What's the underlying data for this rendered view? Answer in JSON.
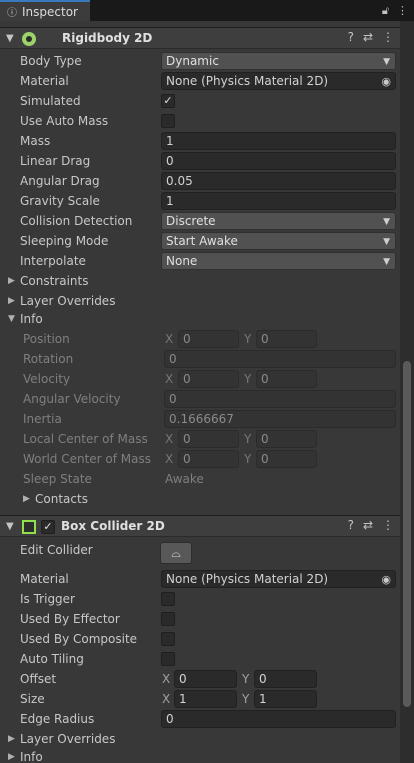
{
  "tab": {
    "label": "Inspector",
    "icon": "info-icon"
  },
  "rigidbody": {
    "title": "Rigidbody 2D",
    "body_type": {
      "label": "Body Type",
      "value": "Dynamic"
    },
    "material": {
      "label": "Material",
      "value": "None (Physics Material 2D)"
    },
    "simulated": {
      "label": "Simulated",
      "checked": true
    },
    "use_auto_mass": {
      "label": "Use Auto Mass",
      "checked": false
    },
    "mass": {
      "label": "Mass",
      "value": "1"
    },
    "linear_drag": {
      "label": "Linear Drag",
      "value": "0"
    },
    "angular_drag": {
      "label": "Angular Drag",
      "value": "0.05"
    },
    "gravity_scale": {
      "label": "Gravity Scale",
      "value": "1"
    },
    "collision_detection": {
      "label": "Collision Detection",
      "value": "Discrete"
    },
    "sleeping_mode": {
      "label": "Sleeping Mode",
      "value": "Start Awake"
    },
    "interpolate": {
      "label": "Interpolate",
      "value": "None"
    },
    "constraints": "Constraints",
    "layer_overrides": "Layer Overrides",
    "info": {
      "label": "Info",
      "position": {
        "label": "Position",
        "x": "0",
        "y": "0"
      },
      "rotation": {
        "label": "Rotation",
        "value": "0"
      },
      "velocity": {
        "label": "Velocity",
        "x": "0",
        "y": "0"
      },
      "angular_velocity": {
        "label": "Angular Velocity",
        "value": "0"
      },
      "inertia": {
        "label": "Inertia",
        "value": "0.1666667"
      },
      "local_center": {
        "label": "Local Center of Mass",
        "x": "0",
        "y": "0"
      },
      "world_center": {
        "label": "World Center of Mass",
        "x": "0",
        "y": "0"
      },
      "sleep_state": {
        "label": "Sleep State",
        "value": "Awake"
      },
      "contacts": "Contacts"
    }
  },
  "box_collider": {
    "title": "Box Collider 2D",
    "enabled": true,
    "edit_collider": {
      "label": "Edit Collider"
    },
    "material": {
      "label": "Material",
      "value": "None (Physics Material 2D)"
    },
    "is_trigger": {
      "label": "Is Trigger",
      "checked": false
    },
    "used_by_effector": {
      "label": "Used By Effector",
      "checked": false
    },
    "used_by_composite": {
      "label": "Used By Composite",
      "checked": false
    },
    "auto_tiling": {
      "label": "Auto Tiling",
      "checked": false
    },
    "offset": {
      "label": "Offset",
      "x": "0",
      "y": "0"
    },
    "size": {
      "label": "Size",
      "x": "1",
      "y": "1"
    },
    "edge_radius": {
      "label": "Edge Radius",
      "value": "0"
    },
    "layer_overrides": "Layer Overrides",
    "info": "Info"
  },
  "axis": {
    "x": "X",
    "y": "Y"
  },
  "colors": {
    "accent": "#3a79bb",
    "rigidbody_icon": "#9bd36a",
    "collider_icon": "#8fe04a"
  }
}
